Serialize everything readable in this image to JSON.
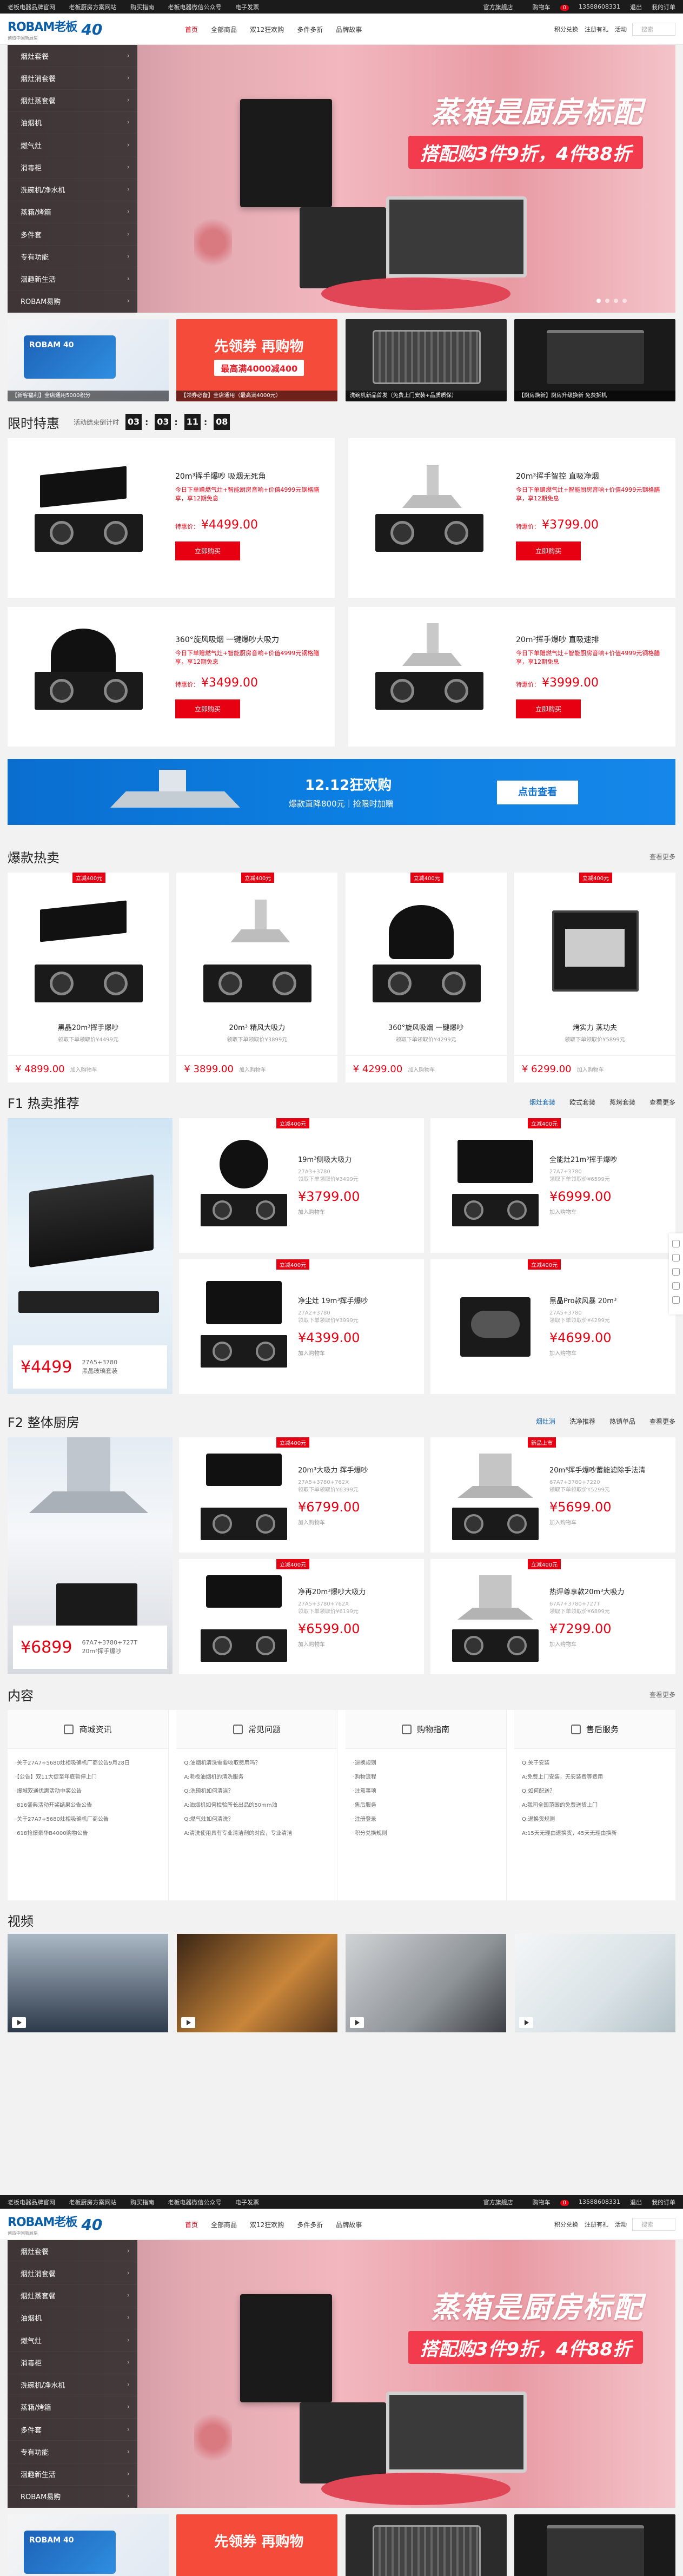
{
  "topbar": {
    "links": [
      "老板电器品牌官网",
      "老板厨房方案网站",
      "购买指南",
      "老板电器微信公众号",
      "电子发票"
    ],
    "right": [
      "官方旗舰店",
      "购物车"
    ],
    "cart_count": "0",
    "account": "13588608331",
    "logout": "退出",
    "orders": "我的订单"
  },
  "header": {
    "brand": "ROBAM老板",
    "slogan": "创造中国新厨房",
    "anniversary": "40",
    "nav": [
      "首页",
      "全部商品",
      "双12狂欢购",
      "多件多折",
      "品牌故事"
    ],
    "right_links": [
      "积分兑换",
      "注册有礼",
      "活动"
    ],
    "search_placeholder": "搜索"
  },
  "sidebar": [
    "烟灶套餐",
    "烟灶消套餐",
    "烟灶蒸套餐",
    "油烟机",
    "燃气灶",
    "消毒柜",
    "洗碗机/净水机",
    "蒸箱/烤箱",
    "多件套",
    "专有功能",
    "洄趣新生活",
    "ROBAM易购"
  ],
  "banner": {
    "title": "蒸箱是厨房标配",
    "subtitle": "搭配购3件9折，4件88折",
    "dots": 4
  },
  "minibanners": [
    {
      "caption": "【新客福利】全店通用5000积分",
      "card": "ROBAM 40"
    },
    {
      "title": "先领券 再购物",
      "sub": "最高满4000减400",
      "caption": "【领券必备】全店通用（最高满4000元）"
    },
    {
      "caption": "洗碗机新品首发（免费上门安装+品质质保）"
    },
    {
      "caption": "【厨房焕新】厨房升级换新 免费拆机"
    }
  ],
  "flash": {
    "title": "限时特惠",
    "countdown_label": "活动结束倒计时",
    "countdown": [
      "03",
      "03",
      "11",
      "08"
    ],
    "buy_label": "立即购买",
    "price_label": "特惠价：",
    "items": [
      {
        "name": "20m³挥手爆吵 吸烟无死角",
        "desc": "今日下单赠燃气灶+智能厨房音响+价值4999元钢格膳享，享12期免息",
        "price": "¥4499.00"
      },
      {
        "name": "20m³挥手智控 直吸净烟",
        "desc": "今日下单赠燃气灶+智能厨房音响+价值4999元钢格膳享，享12期免息",
        "price": "¥3799.00"
      },
      {
        "name": "360°旋风吸烟 一键爆吵大吸力",
        "desc": "今日下单赠燃气灶+智能厨房音响+价值4999元钢格膳享，享12期免息",
        "price": "¥3499.00"
      },
      {
        "name": "20m³挥手爆吵 直吸速排",
        "desc": "今日下单赠燃气灶+智能厨房音响+价值4999元钢格膳享，享12期免息",
        "price": "¥3999.00"
      }
    ]
  },
  "promo_bar": {
    "title": "12.12狂欢购",
    "sub": "爆款直降800元｜抢限时加赠",
    "button": "点击查看"
  },
  "hot": {
    "title": "爆款热卖",
    "more": "查看更多",
    "tag": "立减400元",
    "cart": "加入购物车",
    "items": [
      {
        "name": "黑晶20m³挥手爆吵",
        "sub": "领取下单领取价¥4499元",
        "price": "¥ 4899.00"
      },
      {
        "name": "20m³ 精风大吸力",
        "sub": "领取下单领取价¥3899元",
        "price": "¥ 3899.00"
      },
      {
        "name": "360°旋风吸烟 一键爆吵",
        "sub": "领取下单领取价¥4299元",
        "price": "¥ 4299.00"
      },
      {
        "name": "烤实力 蒸功夫",
        "sub": "领取下单领取价¥5899元",
        "price": "¥ 6299.00"
      }
    ]
  },
  "f1": {
    "title": "F1  热卖推荐",
    "tabs": [
      "烟灶套装",
      "欧式套装",
      "蒸烤套装",
      "查看更多"
    ],
    "hero_price": "¥4499",
    "hero_model": "27A5+3780",
    "hero_name": "黑晶玻璃套装",
    "tag": "立减400元",
    "items": [
      {
        "name": "19m³侧吸大吸力",
        "sub1": "27A3+3780",
        "sub2": "领取下单领取价¥3499元",
        "price": "¥3799.00",
        "cart": "加入购物车"
      },
      {
        "name": "全能灶21m³挥手爆吵",
        "sub1": "27A7+3780",
        "sub2": "领取下单领取价¥6599元",
        "price": "¥6999.00",
        "cart": "加入购物车"
      },
      {
        "name": "净尘灶 19m³挥手爆吵",
        "sub1": "27A2+3780",
        "sub2": "领取下单领取价¥3999元",
        "price": "¥4399.00",
        "cart": "加入购物车"
      },
      {
        "name": "黑晶Pro款风暴 20m³",
        "sub1": "27A5+3780",
        "sub2": "领取下单领取价¥4299元",
        "price": "¥4699.00",
        "cart": "加入购物车"
      }
    ]
  },
  "f2": {
    "title": "F2  整体厨房",
    "tabs": [
      "烟灶消",
      "洗净推荐",
      "热销单品",
      "查看更多"
    ],
    "hero_price": "¥6899",
    "hero_model": "67A7+3780+727T",
    "hero_name": "20m³挥手爆吵",
    "tag": "立减400元",
    "tag_new": "新品上市",
    "items": [
      {
        "name": "20m³大吸力 挥手爆吵",
        "sub1": "27A5+3780+762X",
        "sub2": "领取下单领取价¥6399元",
        "price": "¥6799.00",
        "cart": "加入购物车"
      },
      {
        "name": "20m³挥手爆吵蓄能滤除手法清",
        "sub1": "67A7+3780+7220",
        "sub2": "领取下单领取价¥5299元",
        "price": "¥5699.00",
        "cart": "加入购物车"
      },
      {
        "name": "净再20m³爆吵大吸力",
        "sub1": "27A5+3780+762X",
        "sub2": "领取下单领取价¥6199元",
        "price": "¥6599.00",
        "cart": "加入购物车"
      },
      {
        "name": "热评尊享款20m³大吸力",
        "sub1": "67A7+3780+727T",
        "sub2": "领取下单领取价¥6899元",
        "price": "¥7299.00",
        "cart": "加入购物车"
      }
    ]
  },
  "content": {
    "title": "内容",
    "more": "查看更多",
    "cols": [
      {
        "title": "商城资讯",
        "items": [
          "·关于27A7+5680灶相吸确机厂商公告9月28日",
          "·【公告】双11大促至年底暂停上门",
          "·爆城双通优惠活动中奖公告",
          "·816盛典活动开奖结果公告公告",
          "·关于27A7+5680灶相吸确机厂商公告",
          "·618抢爆豪华B4000购物公告"
        ]
      },
      {
        "title": "常见问题",
        "items": [
          "Q:油烟机清洗需要收取费用吗？",
          "A:老板油烟机的清洗服务",
          "Q:洗碗机如何清洁？",
          "A:油烟机如何检验所长出品的50mm油",
          "Q:燃气灶如何清洗？",
          "A:清洗使用具有专业清洁剂的对应，专业清洁"
        ]
      },
      {
        "title": "购物指南",
        "items": [
          "·退换规则",
          "·购物流程",
          "·注意事项",
          "·售后服务",
          "·注册登录",
          "·积分兑换规则"
        ]
      },
      {
        "title": "售后服务",
        "items": [
          "Q:关于安装",
          "A:免费上门安装，无安装费等费用",
          "Q:如何配送？",
          "A:我司全国范围的免费送货上门",
          "Q:退换货规则",
          "A:15天无理由退换货，45天无理由换新"
        ]
      }
    ]
  },
  "videos": {
    "title": "视频",
    "count": 4
  }
}
